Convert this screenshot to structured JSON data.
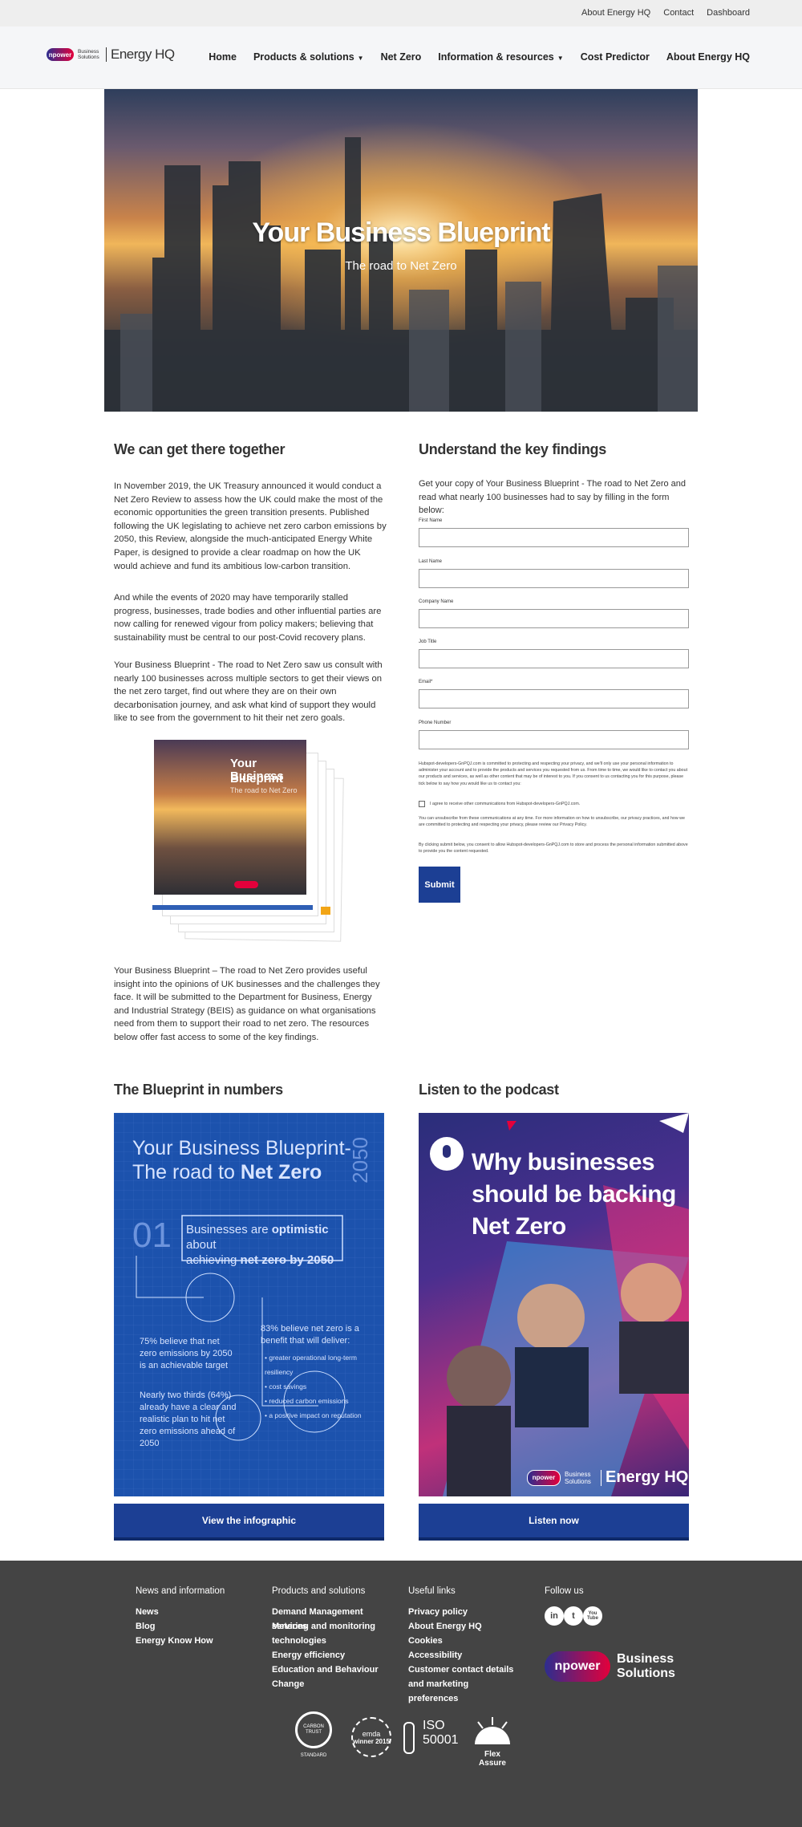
{
  "topbar": {
    "links": [
      "About Energy HQ",
      "Contact",
      "Dashboard"
    ]
  },
  "header": {
    "logo": {
      "badge": "npower",
      "small": "Business Solutions",
      "brand": "Energy HQ"
    },
    "nav": [
      {
        "label": "Home",
        "dropdown": false
      },
      {
        "label": "Products & solutions",
        "dropdown": true
      },
      {
        "label": "Net Zero",
        "dropdown": false
      },
      {
        "label": "Information & resources",
        "dropdown": true
      },
      {
        "label": "Cost Predictor",
        "dropdown": false
      },
      {
        "label": "About Energy HQ",
        "dropdown": false
      }
    ]
  },
  "hero": {
    "title": "Your Business Blueprint",
    "subtitle": "The road to Net Zero"
  },
  "intro": {
    "heading": "We can get there together",
    "paragraphs": [
      "In November 2019, the UK Treasury announced it would conduct a Net Zero Review to assess how the UK could make the most of the economic opportunities the green transition presents. Published following the UK legislating to achieve net zero carbon emissions by 2050, this Review, alongside the much-anticipated Energy White Paper, is designed to provide a clear roadmap on how the UK would achieve and fund its ambitious low-carbon transition.",
      "And while the events of 2020 may have temporarily stalled progress, businesses, trade bodies and other influential parties are now calling for renewed vigour from policy makers; believing that sustainability must be central to our post-Covid recovery plans.",
      "Your Business Blueprint - The road to Net Zero saw us consult with nearly 100 businesses across multiple sectors to get their views on the net zero target, find out where they are on their own decarbonisation journey, and ask what kind of support they would like to see from the government to hit their net zero goals."
    ],
    "closing": "Your Business Blueprint – The road to Net Zero provides useful insight into the opinions of UK businesses and the challenges they face. It will be submitted to the Department for Business, Energy and Industrial Strategy (BEIS) as guidance on what organisations need from them to support their road to net zero. The resources below offer fast access to some of the key findings.",
    "book": {
      "title_line1": "Your Business",
      "title_line2": "Blueprint",
      "subtitle": "The road to Net Zero"
    }
  },
  "form": {
    "heading": "Understand the key findings",
    "intro": "Get your copy of Your Business Blueprint - The road to Net Zero and read what nearly 100 businesses had to say by filling in the form below:",
    "fields": [
      {
        "label": "First Name",
        "value": ""
      },
      {
        "label": "Last Name",
        "value": ""
      },
      {
        "label": "Company Name",
        "value": ""
      },
      {
        "label": "Job Title",
        "value": ""
      },
      {
        "label": "Email*",
        "value": ""
      },
      {
        "label": "Phone Number",
        "value": ""
      }
    ],
    "privacy": "Hubspot-developers-GnPQJ.com is committed to protecting and respecting your privacy, and we'll only use your personal information to administer your account and to provide the products and services you requested from us. From time to time, we would like to contact you about our products and services, as well as other content that may be of interest to you. If you consent to us contacting you for this purpose, please tick below to say how you would like us to contact you:",
    "checkbox_label": "I agree to receive other communications from Hubspot-developers-GnPQJ.com.",
    "unsubscribe": "You can unsubscribe from these communications at any time. For more information on how to unsubscribe, our privacy practices, and how we are committed to protecting and respecting your privacy, please review our Privacy Policy.",
    "consent": "By clicking submit below, you consent to allow Hubspot-developers-GnPQJ.com to store and process the personal information submitted above to provide you the content requested.",
    "submit": "Submit"
  },
  "numbers": {
    "heading": "The Blueprint in numbers",
    "infographic": {
      "title1": "Your Business Blueprint-",
      "title2a": "The road to ",
      "title2b": "Net Zero",
      "year": "2050",
      "section": "01",
      "box_line1a": "Businesses are ",
      "box_line1b": "optimistic",
      "box_line1c": " about",
      "box_line2a": "achieving ",
      "box_line2b": "net zero by 2050",
      "stat1": "75% believe that net zero emissions by 2050 is an achievable target",
      "stat2": "Nearly two thirds (64%) already have a clear and realistic plan to hit net zero emissions ahead of 2050",
      "stat3_head": "83% believe net zero is a benefit that will deliver:",
      "stat3_items": [
        "greater operational long-term resiliency",
        "cost savings",
        "reduced carbon emissions",
        "a positive impact on reputation"
      ]
    },
    "button": "View the infographic"
  },
  "podcast": {
    "heading": "Listen to the podcast",
    "title": "Why businesses should be backing Net Zero",
    "brand_badge": "npower",
    "brand_small": "Business Solutions",
    "brand_name": "Energy HQ",
    "button": "Listen now"
  },
  "footer": {
    "columns": [
      {
        "heading": "News and information",
        "links": [
          "News",
          "Blog",
          "Energy Know How"
        ]
      },
      {
        "heading": "Products and solutions",
        "links": [
          "Demand Management services",
          "Metering and monitoring technologies",
          "Energy efficiency",
          "Education and Behaviour Change"
        ]
      },
      {
        "heading": "Useful links",
        "links": [
          "Privacy policy",
          "About Energy HQ",
          "Cookies",
          "Accessibility",
          "Customer contact details and marketing preferences"
        ]
      },
      {
        "heading": "Follow us",
        "links": []
      }
    ],
    "social": [
      "in",
      "t",
      "You Tube"
    ],
    "brand": {
      "badge": "npower",
      "line1": "Business",
      "line2": "Solutions"
    },
    "certs": [
      {
        "top": "CARBON TRUST",
        "bottom": "STANDARD"
      },
      {
        "top": "emda",
        "bottom": "winner 2015"
      },
      {
        "top": "ISO",
        "bottom": "50001"
      },
      {
        "top": "",
        "bottom": "Flex Assure"
      }
    ]
  }
}
